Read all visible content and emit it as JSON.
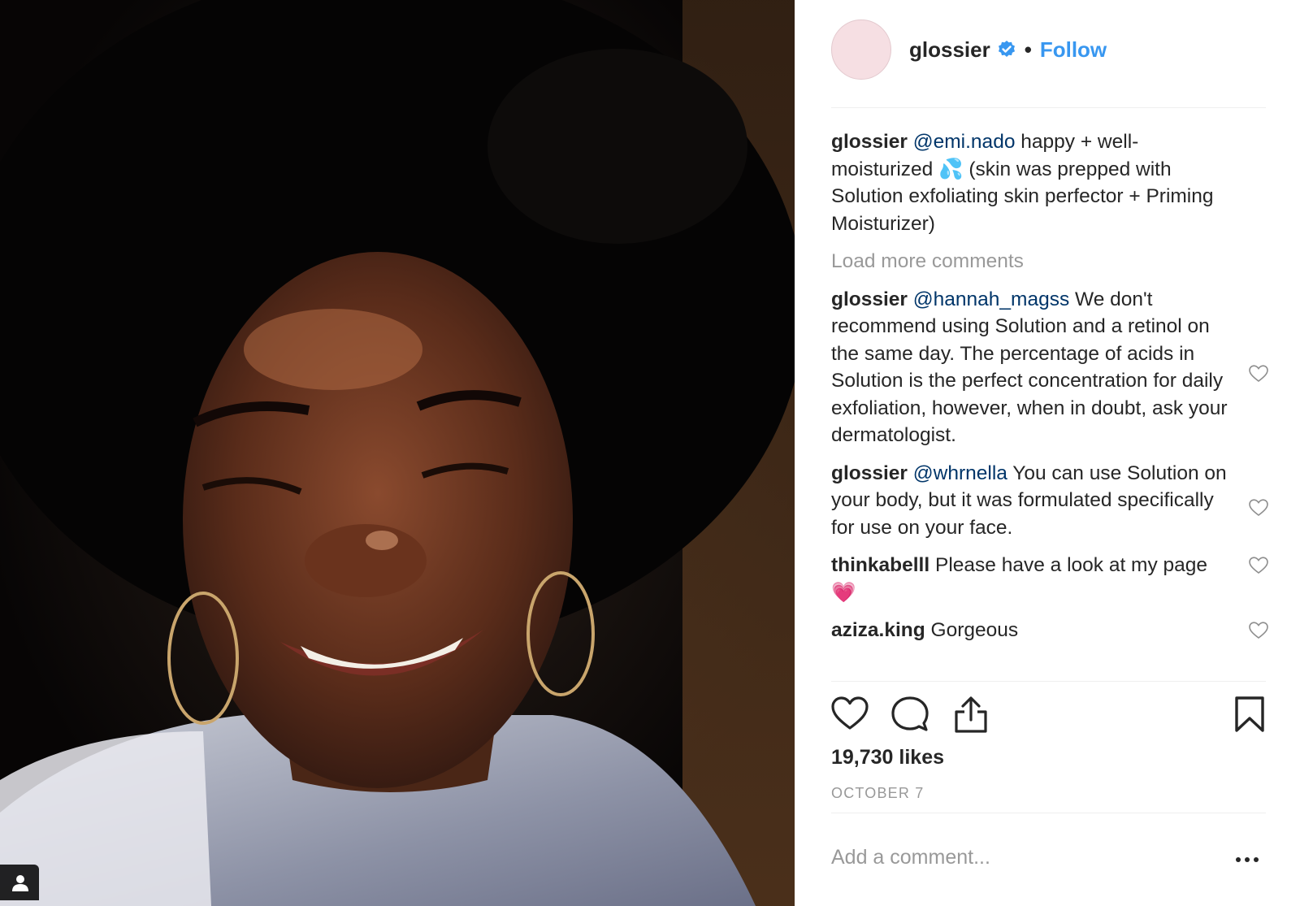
{
  "post": {
    "username": "glossier",
    "follow_label": "Follow",
    "separator": "•",
    "likes": "19,730 likes",
    "date": "OCTOBER 7",
    "add_comment_placeholder": "Add a comment...",
    "load_more": "Load more comments"
  },
  "caption": {
    "user": "glossier",
    "mention": "@emi.nado",
    "text": " happy + well-moisturized 💦  (skin was prepped with Solution exfoliating skin perfector + Priming Moisturizer)"
  },
  "comments": [
    {
      "user": "glossier",
      "mention": "@hannah_magss",
      "text": " We don't recommend using Solution and a retinol on the same day. The percentage of acids in Solution is the perfect concentration for daily exfoliation, however, when in doubt, ask your dermatologist."
    },
    {
      "user": "glossier",
      "mention": "@whrnella",
      "text": " You can use Solution on your body, but it was formulated specifically for use on your face."
    },
    {
      "user": "thinkabelll",
      "mention": "",
      "text": " Please have a look at my page 💗"
    },
    {
      "user": "aziza.king",
      "mention": "",
      "text": " Gorgeous"
    }
  ],
  "icons": {
    "verified": "verified-badge-icon",
    "like": "heart-icon",
    "comment": "comment-bubble-icon",
    "share": "share-icon",
    "save": "bookmark-icon",
    "more": "more-dots-icon",
    "tag": "user-tag-icon"
  },
  "colors": {
    "link_blue": "#3897f0",
    "mention_blue": "#003569",
    "text": "#262626",
    "muted": "#999999",
    "divider": "#efefef",
    "avatar_bg": "#f6dfe3"
  }
}
